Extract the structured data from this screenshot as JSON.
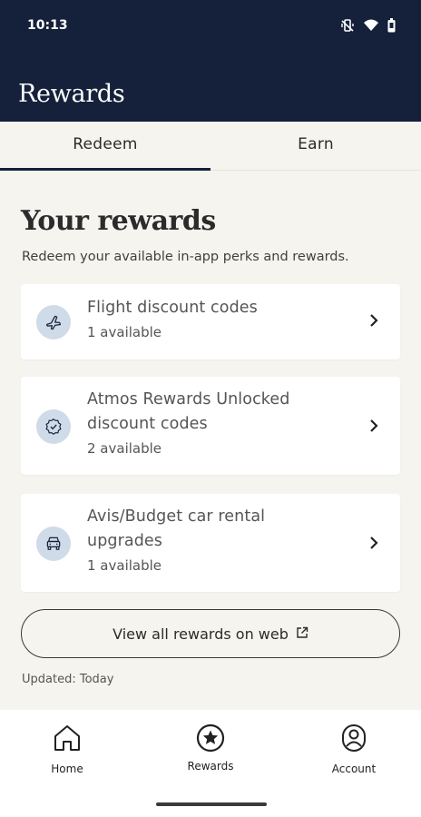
{
  "status_bar": {
    "time": "10:13",
    "icons": [
      "vibrate-off-icon",
      "wifi-icon",
      "battery-icon"
    ]
  },
  "header": {
    "title": "Rewards"
  },
  "tabs": [
    {
      "label": "Redeem",
      "active": true
    },
    {
      "label": "Earn",
      "active": false
    }
  ],
  "main": {
    "title": "Your rewards",
    "subtitle": "Redeem your available in-app perks and rewards.",
    "rewards": [
      {
        "icon": "airplane-icon",
        "title": "Flight discount codes",
        "availability": "1 available"
      },
      {
        "icon": "badge-check-icon",
        "title_line1": "Atmos Rewards Unlocked",
        "title_line2": "discount codes",
        "availability": "2 available"
      },
      {
        "icon": "car-icon",
        "title_line1": "Avis/Budget car rental",
        "title_line2": "upgrades",
        "availability": "1 available"
      }
    ],
    "web_button_label": "View all rewards on web",
    "updated_text": "Updated: Today"
  },
  "bottom_nav": {
    "items": [
      {
        "label": "Home",
        "icon": "home-icon"
      },
      {
        "label": "Rewards",
        "icon": "star-circle-icon",
        "active": true
      },
      {
        "label": "Account",
        "icon": "account-icon"
      }
    ]
  },
  "colors": {
    "header_bg": "#15213a",
    "page_bg": "#f6f4ef",
    "card_bg": "#ffffff",
    "icon_circle": "#cfdbe8"
  }
}
